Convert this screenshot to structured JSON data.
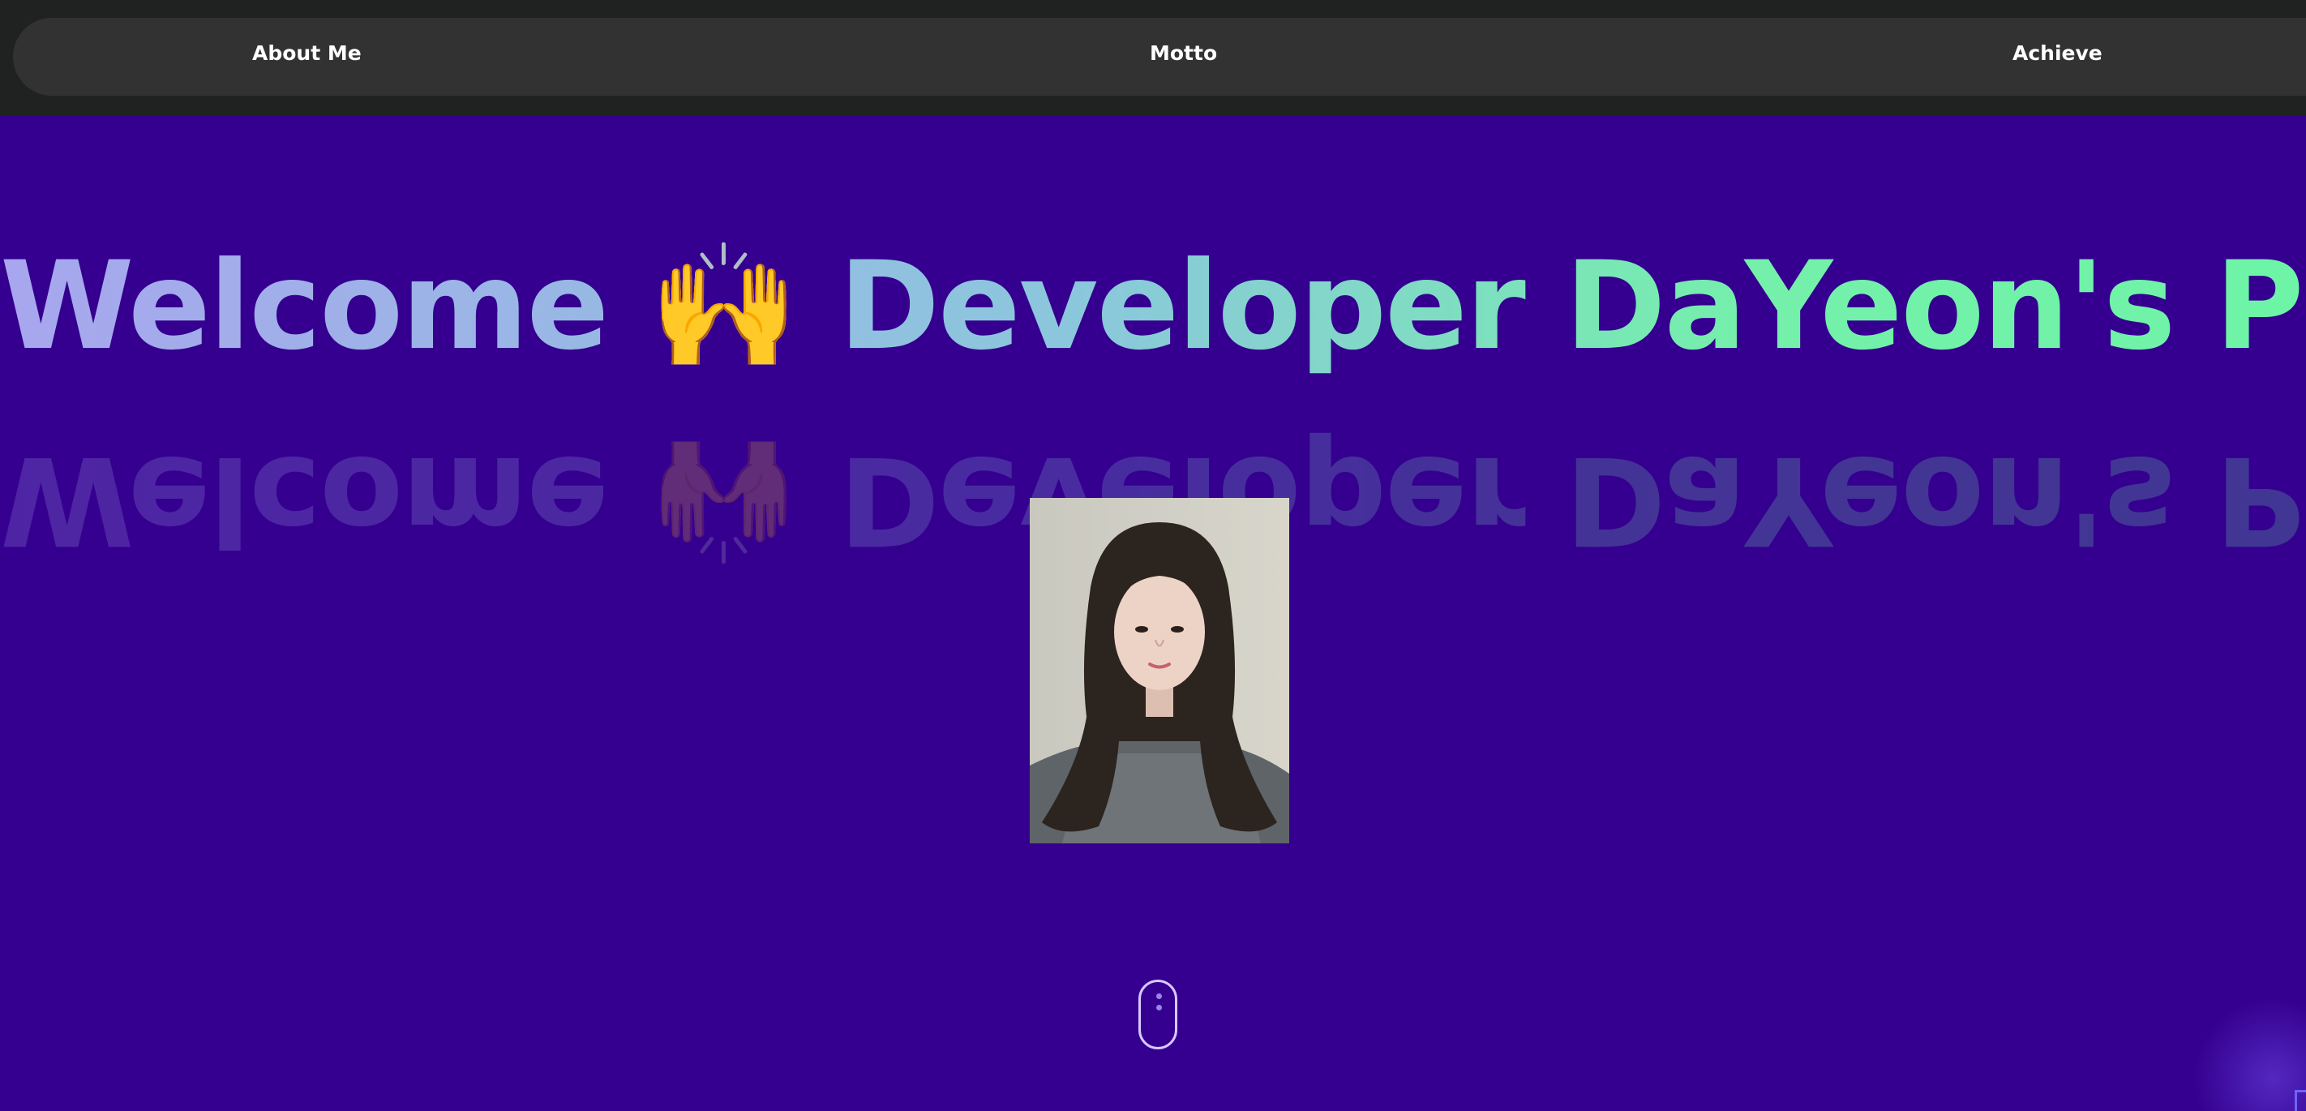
{
  "nav": {
    "items": [
      {
        "label": "About Me"
      },
      {
        "label": "Motto"
      },
      {
        "label": "Achieve"
      }
    ]
  },
  "hero": {
    "headline_before": "Welcome ",
    "headline_emoji": "🙌",
    "headline_after": " Developer DaYeon's Portfolio.",
    "photo_icon": "portrait-photo",
    "scroll_icon": "mouse-scroll-icon",
    "scroll_hint": "..."
  },
  "colors": {
    "background": "#35008f",
    "topbar": "#202222",
    "nav_pill": "#323232",
    "gradient_start": "#a8a6ee",
    "gradient_end": "#68f8a4"
  }
}
